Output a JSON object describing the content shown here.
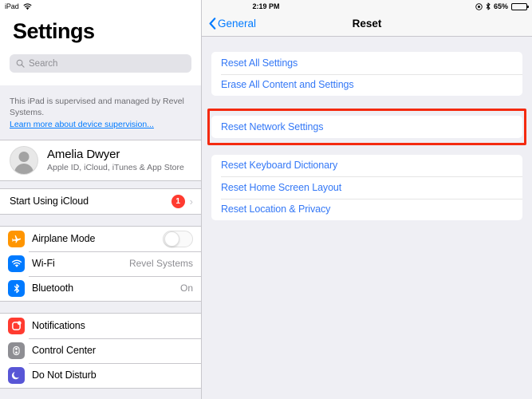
{
  "statusbar": {
    "carrier": "iPad",
    "wifi_icon": "wifi-icon",
    "time": "2:19 PM",
    "rotation_lock_icon": "rotation-lock-icon",
    "bluetooth_icon": "bluetooth-icon",
    "battery_percent": "65%",
    "battery_icon": "battery-icon"
  },
  "sidebar": {
    "title": "Settings",
    "search": {
      "placeholder": "Search",
      "value": "",
      "icon": "search-icon"
    },
    "supervision": {
      "text": "This iPad is supervised and managed by Revel Systems.",
      "link": "Learn more about device supervision..."
    },
    "account": {
      "name": "Amelia Dwyer",
      "subtitle": "Apple ID, iCloud, iTunes & App Store",
      "avatar": "avatar"
    },
    "icloud_row": {
      "label": "Start Using iCloud",
      "badge": "1",
      "chevron": "chevron-right-icon"
    },
    "connectivity": [
      {
        "label": "Airplane Mode",
        "icon": "airplane-icon",
        "icon_color": "#FF9500",
        "control": "toggle",
        "toggle_on": false
      },
      {
        "label": "Wi-Fi",
        "icon": "wifi-icon",
        "icon_color": "#007AFF",
        "control": "value",
        "value": "Revel Systems"
      },
      {
        "label": "Bluetooth",
        "icon": "bluetooth-icon",
        "icon_color": "#007AFF",
        "control": "value",
        "value": "On"
      }
    ],
    "general_group": [
      {
        "label": "Notifications",
        "icon": "notifications-icon",
        "icon_color": "#FF3B30"
      },
      {
        "label": "Control Center",
        "icon": "control-center-icon",
        "icon_color": "#8E8E93"
      },
      {
        "label": "Do Not Disturb",
        "icon": "do-not-disturb-icon",
        "icon_color": "#5856D6"
      }
    ]
  },
  "detail": {
    "back_label": "General",
    "back_icon": "chevron-left-icon",
    "title": "Reset",
    "group1": [
      {
        "label": "Reset All Settings"
      },
      {
        "label": "Erase All Content and Settings"
      }
    ],
    "highlighted": {
      "label": "Reset Network Settings",
      "highlight_color": "#F42A10"
    },
    "group3": [
      {
        "label": "Reset Keyboard Dictionary"
      },
      {
        "label": "Reset Home Screen Layout"
      },
      {
        "label": "Reset Location & Privacy"
      }
    ]
  }
}
